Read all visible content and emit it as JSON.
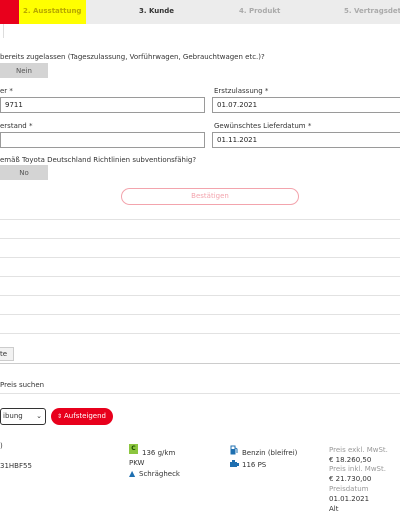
{
  "stepper": {
    "step2": "2. Ausstattung",
    "step3": "3. Kunde",
    "step4": "4. Produkt",
    "step5": "5. Vertragsdet"
  },
  "form": {
    "question1": "bereits zugelassen (Tageszulassung, Vorführwagen, Gebrauchtwagen etc.)?",
    "nein_button": "Nein",
    "field_left1_label": "er *",
    "field_left1_value": "9711",
    "field_right1_label": "Erstzulassung *",
    "field_right1_value": "01.07.2021",
    "field_left2_label": "erstand *",
    "field_right2_label": "Gewünschtes Lieferdatum *",
    "field_right2_value": "01.11.2021",
    "question2": "emäß Toyota Deutschland Richtlinien subventionsfähig?",
    "no_button": "No",
    "confirm_button": "Bestätigen"
  },
  "section": {
    "label": "te",
    "search_text": "Preis suchen"
  },
  "sorting": {
    "select_value": "ibung",
    "direction_button": "Aufsteigend"
  },
  "result": {
    "col1_line1": ")",
    "col1_line2": "31HBF55",
    "efficiency_class": "C",
    "co2": "136 g/km",
    "vehicle_type": "PKW",
    "body_type": "Schrägheck",
    "fuel": "Benzin (bleifrei)",
    "power": "116 PS",
    "price_excl_label": "Preis exkl. MwSt.",
    "price_excl_value": "€ 18.260,50",
    "price_incl_label": "Preis inkl. MwSt.",
    "price_incl_value": "€ 21.730,00",
    "price_date_label": "Preisdatum",
    "price_date_value": "01.01.2021",
    "status": "Alt"
  },
  "colors": {
    "accent_red": "#e8001c",
    "active_step_yellow": "#ffff00",
    "efficiency_green": "#8cc63f"
  }
}
